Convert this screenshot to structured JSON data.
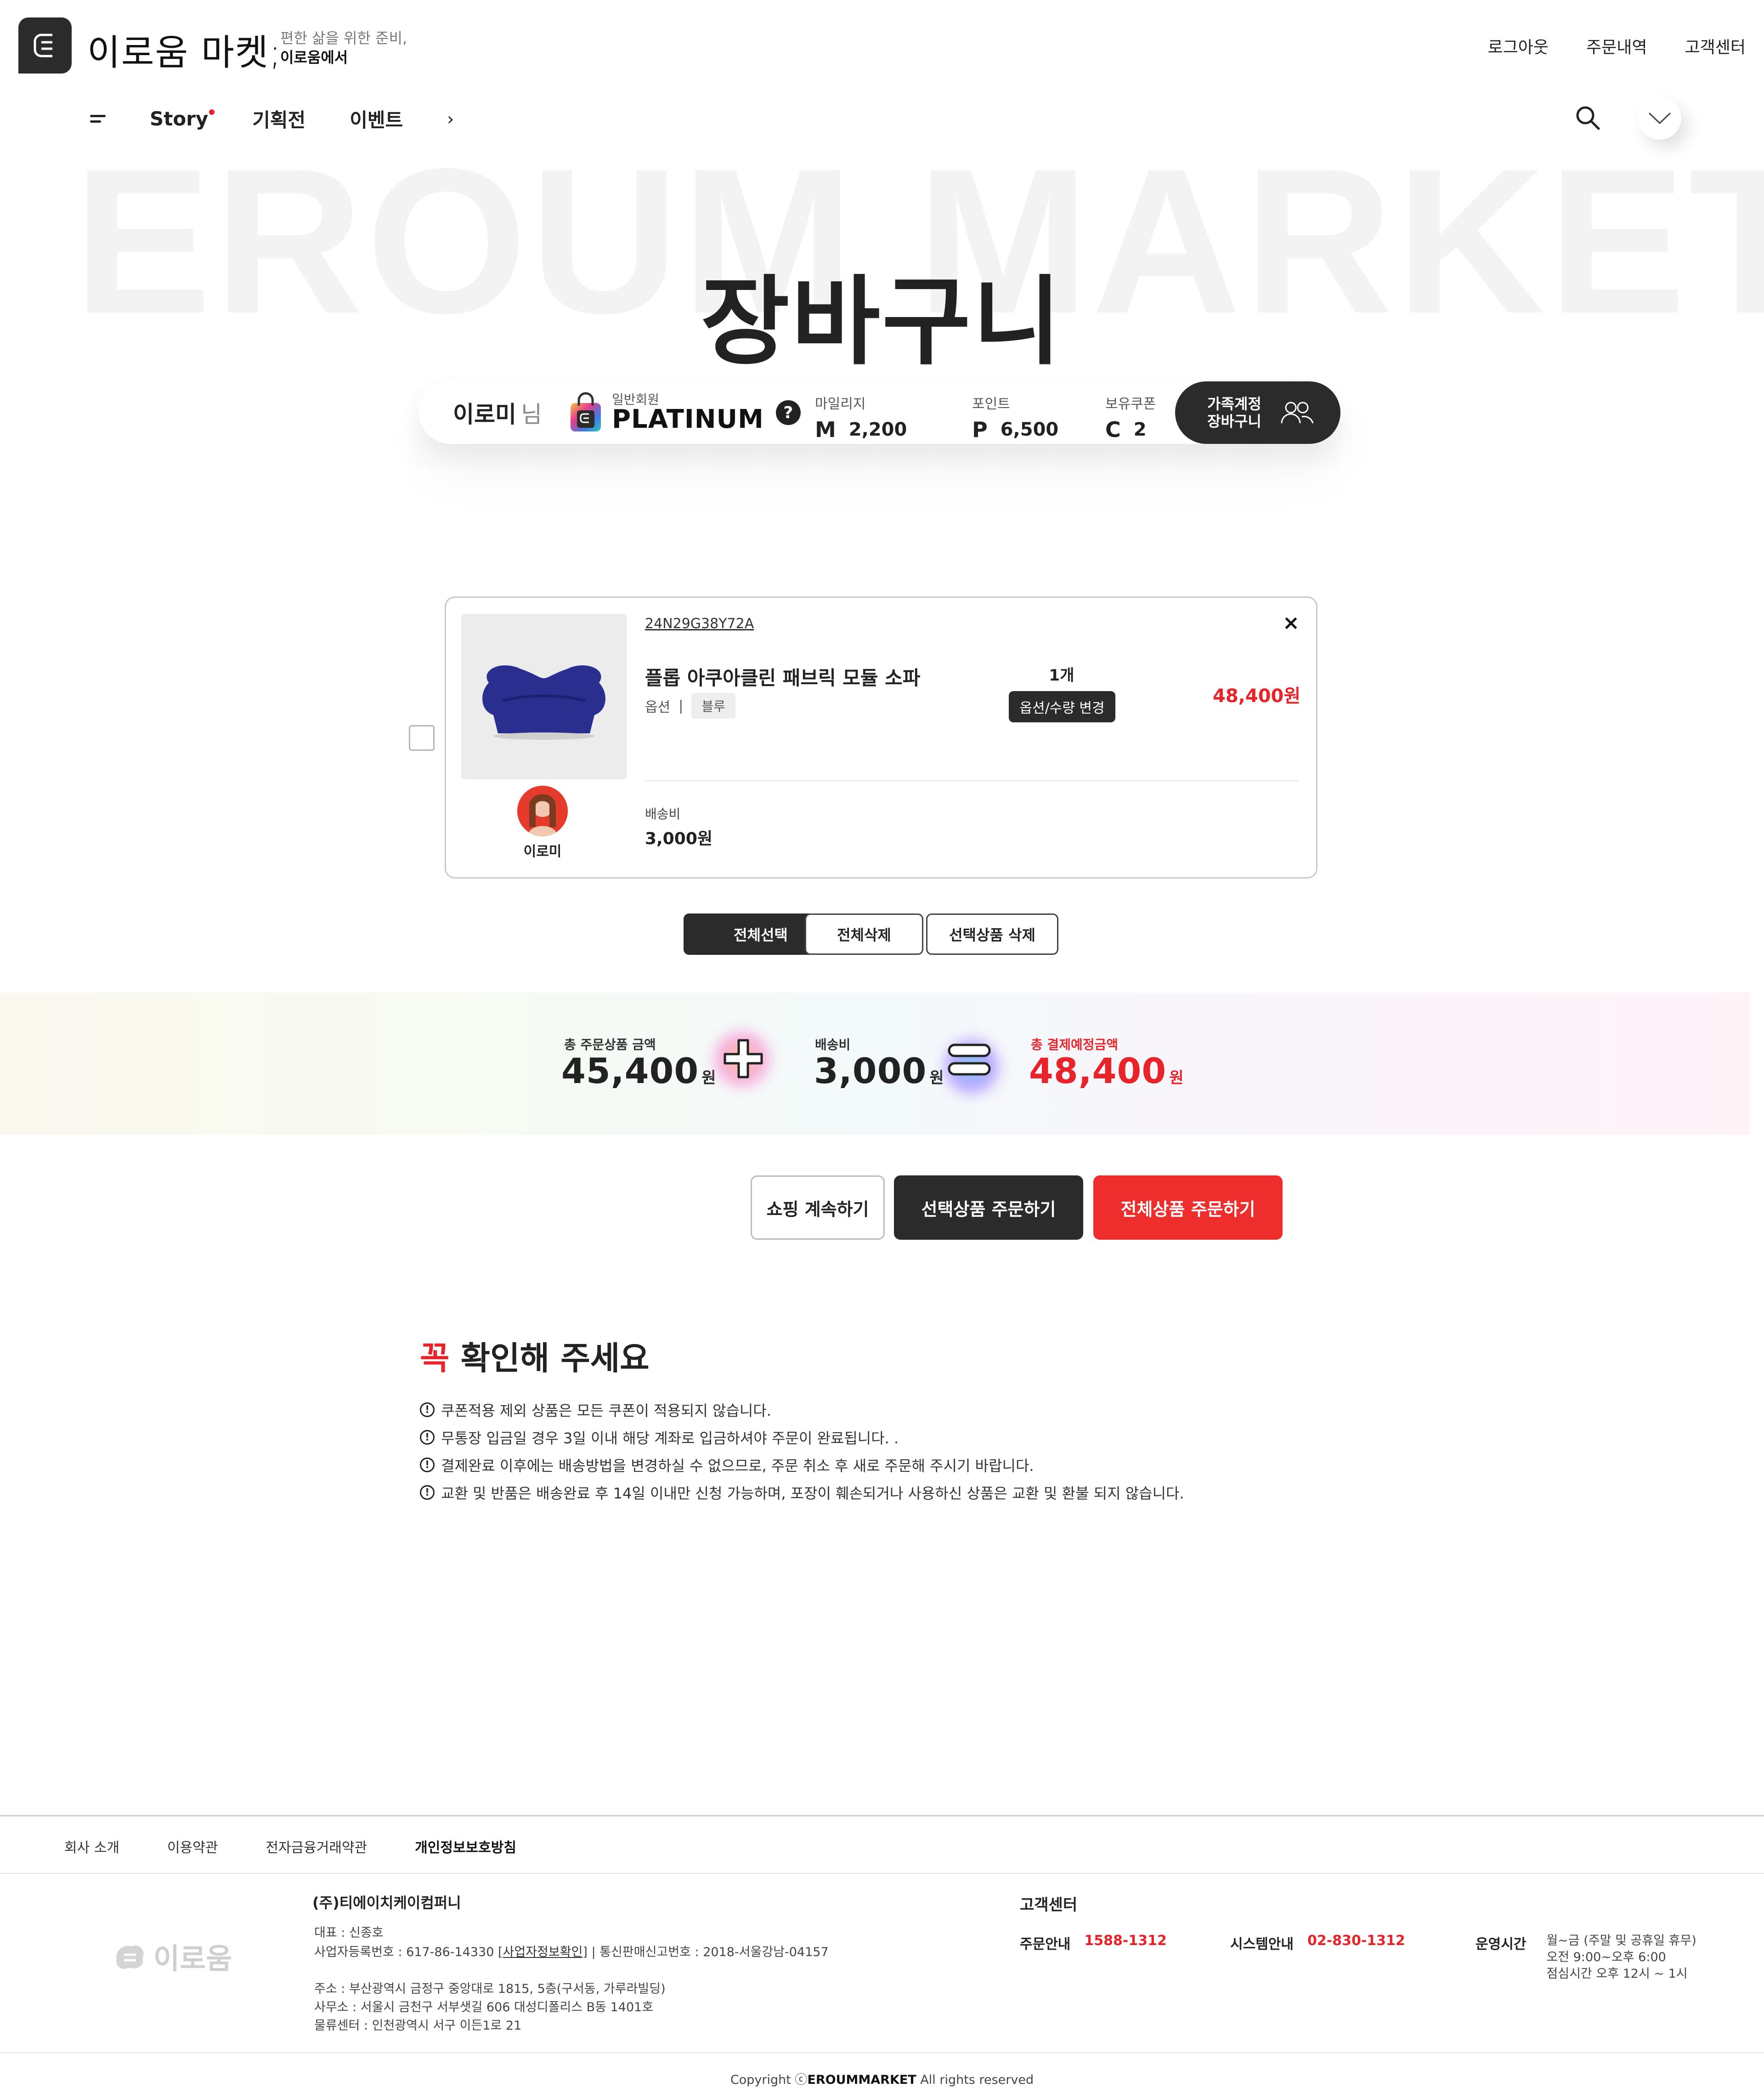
{
  "header": {
    "brand": "이로움 마켓;",
    "tagline_top": "편한 삶을 위한 준비,",
    "tagline_bottom": "이로움에서",
    "links": [
      "로그아웃",
      "주문내역",
      "고객센터"
    ]
  },
  "nav": {
    "items": [
      "Story",
      "기획전",
      "이벤트"
    ],
    "more": "›"
  },
  "watermark": "EROUM MARKET",
  "page_title": "장바구니",
  "member": {
    "name": "이로미",
    "suffix": "님",
    "grade_label": "일반회원",
    "grade": "PLATINUM",
    "help": "?",
    "mileage_label": "마일리지",
    "mileage_symbol": "M",
    "mileage": "2,200",
    "point_label": "포인트",
    "point_symbol": "P",
    "point": "6,500",
    "coupon_label": "보유쿠폰",
    "coupon_symbol": "C",
    "coupon": "2",
    "family_line1": "가족계정",
    "family_line2": "장바구니"
  },
  "cart": {
    "item": {
      "code": "24N29G38Y72A",
      "close": "×",
      "name": "플롭 아쿠아클린 패브릭 모듈 소파",
      "option_label": "옵션",
      "option_value": "블루",
      "quantity": "1개",
      "change_button": "옵션/수량 변경",
      "price": "48,400원",
      "shipping_label": "배송비",
      "shipping": "3,000원",
      "owner": "이로미",
      "product_color": "#2a2f8f"
    },
    "buttons": {
      "select_all": "전체선택",
      "delete_all": "전체삭제",
      "delete_selected": "선택상품 삭제"
    }
  },
  "totals": {
    "products_label": "총 주문상품 금액",
    "products": "45,400",
    "shipping_label": "배송비",
    "shipping": "3,000",
    "total_label": "총 결제예정금액",
    "total": "48,400",
    "unit": "원"
  },
  "order_buttons": {
    "continue": "쇼핑 계속하기",
    "order_selected": "선택상품 주문하기",
    "order_all": "전체상품 주문하기"
  },
  "notice": {
    "title_accent": "꼭",
    "title_rest": " 확인해 주세요",
    "items": [
      "쿠폰적용 제외 상품은 모든 쿠폰이 적용되지 않습니다.",
      "무통장 입금일 경우 3일 이내 해당 계좌로 입금하셔야 주문이 완료됩니다. .",
      "결제완료 이후에는 배송방법을 변경하실 수 없으므로, 주문 취소 후 새로 주문해 주시기 바랍니다.",
      "교환 및 반품은 배송완료 후 14일 이내만 신청 가능하며, 포장이 훼손되거나 사용하신 상품은 교환 및 환불 되지 않습니다."
    ]
  },
  "footer": {
    "links": [
      "회사 소개",
      "이용약관",
      "전자금융거래약관",
      "개인정보보호방침"
    ],
    "logo_text": "이로움",
    "company": "(주)티에이치케이컴퍼니",
    "ceo": "대표 : 신종호",
    "biz_prefix": "사업자등록번호 : 617-86-14330 [",
    "biz_link": "사업자정보확인",
    "biz_suffix": "]   |  통신판매신고번호 : 2018-서울강남-04157",
    "address": "주소 : 부산광역시 금정구 중앙대로 1815, 5층(구서동, 가루라빌딩)",
    "office": "사무소 : 서울시 금천구 서부샛길 606 대성디폴리스 B동 1401호",
    "logistics": "물류센터 : 인천광역시 서구 이든1로 21",
    "cs_title": "고객센터",
    "order_label": "주문안내",
    "order_phone": "1588-1312",
    "system_label": "시스템안내",
    "system_phone": "02-830-1312",
    "hours_label": "운영시간",
    "hours_1": "월~금 (주말 및 공휴일 휴무)",
    "hours_2": "오전 9:00~오후 6:00",
    "hours_3": "점심시간 오후 12시 ~ 1시",
    "copyright_prefix": "Copyright ⓒ",
    "copyright_brand": "EROUMMARKET",
    "copyright_suffix": " All rights reserved"
  }
}
